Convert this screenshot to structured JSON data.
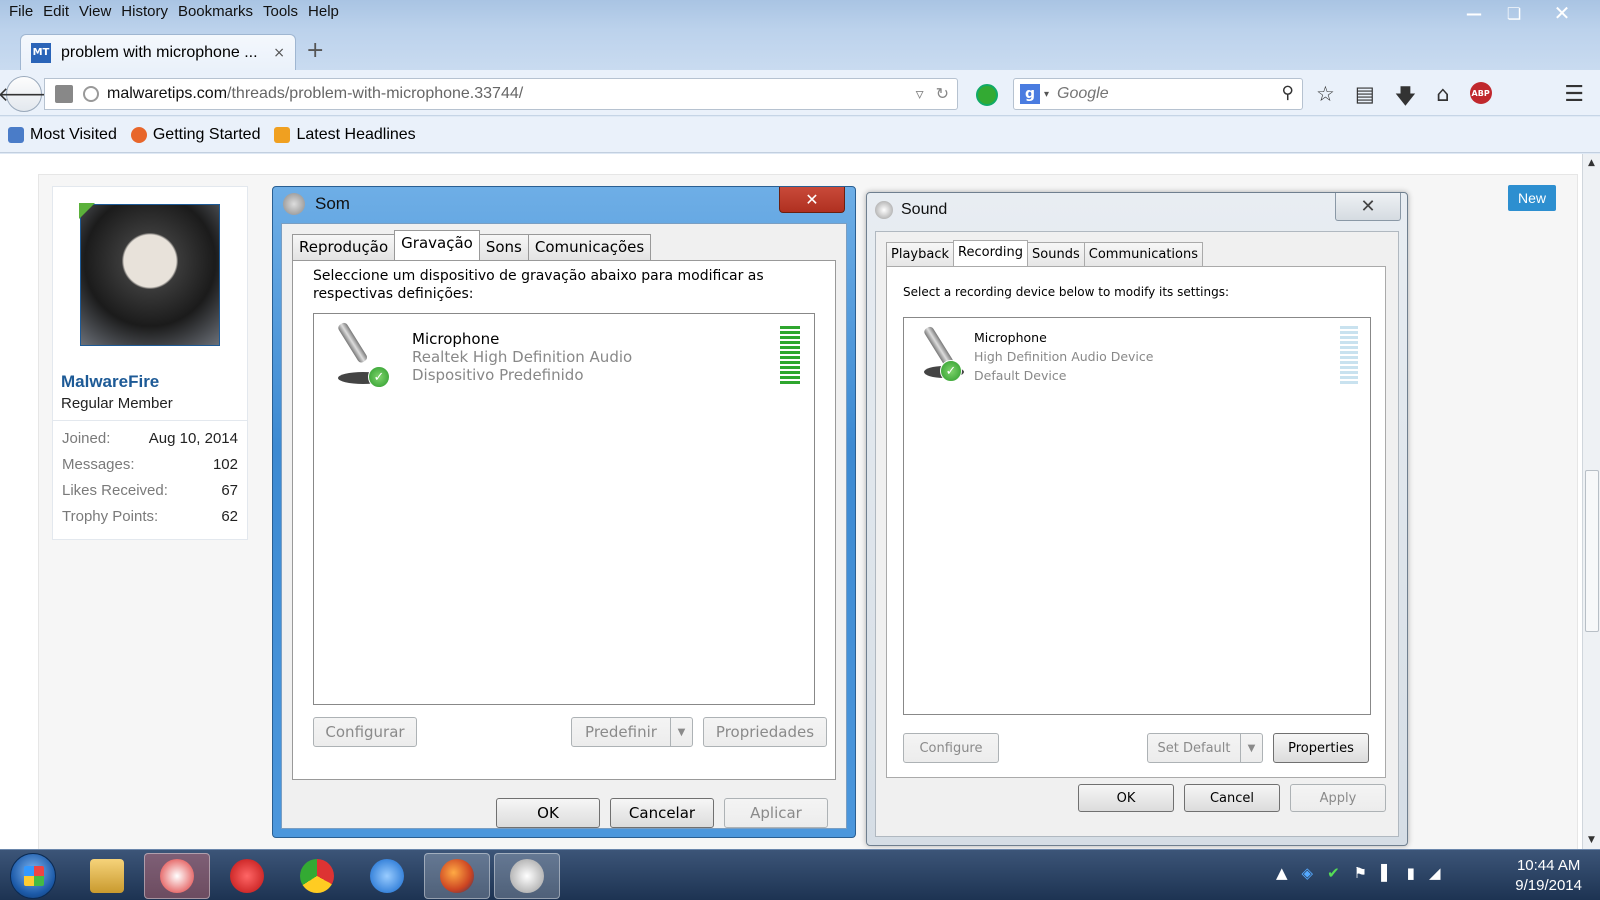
{
  "menu": [
    "File",
    "Edit",
    "View",
    "History",
    "Bookmarks",
    "Tools",
    "Help"
  ],
  "browser_tab": {
    "favicon": "MT",
    "title": "problem with microphone ...",
    "close": "×"
  },
  "new_tab": "+",
  "address": {
    "domain": "malwaretips.com",
    "path": "/threads/problem-with-microphone.33744/"
  },
  "search": {
    "placeholder": "Google",
    "engine": "g"
  },
  "bookmarks": [
    "Most Visited",
    "Getting Started",
    "Latest Headlines"
  ],
  "user": {
    "name": "MalwareFire",
    "title": "Regular Member",
    "stats": [
      {
        "label": "Joined:",
        "value": "Aug 10, 2014"
      },
      {
        "label": "Messages:",
        "value": "102"
      },
      {
        "label": "Likes Received:",
        "value": "67"
      },
      {
        "label": "Trophy Points:",
        "value": "62"
      }
    ]
  },
  "new_badge": "New",
  "som_dialog": {
    "title": "Som",
    "close": "✕",
    "tabs": [
      "Reprodução",
      "Gravação",
      "Sons",
      "Comunicações"
    ],
    "instructions": "Seleccione um dispositivo de gravação abaixo para modificar as respectivas definições:",
    "device": {
      "name": "Microphone",
      "driver": "Realtek High Definition Audio",
      "status": "Dispositivo Predefinido"
    },
    "level": 1.0,
    "buttons": {
      "configure": "Configurar",
      "set_default": "Predefinir",
      "properties": "Propriedades",
      "ok": "OK",
      "cancel": "Cancelar",
      "apply": "Aplicar"
    }
  },
  "sound_dialog": {
    "title": "Sound",
    "close": "✕",
    "tabs": [
      "Playback",
      "Recording",
      "Sounds",
      "Communications"
    ],
    "instructions": "Select a recording device below to modify its settings:",
    "device": {
      "name": "Microphone",
      "driver": "High Definition Audio Device",
      "status": "Default Device"
    },
    "level": 0.0,
    "buttons": {
      "configure": "Configure",
      "set_default": "Set Default",
      "properties": "Properties",
      "ok": "OK",
      "cancel": "Cancel",
      "apply": "Apply"
    }
  },
  "clock": {
    "time": "10:44 AM",
    "date": "9/19/2014"
  }
}
